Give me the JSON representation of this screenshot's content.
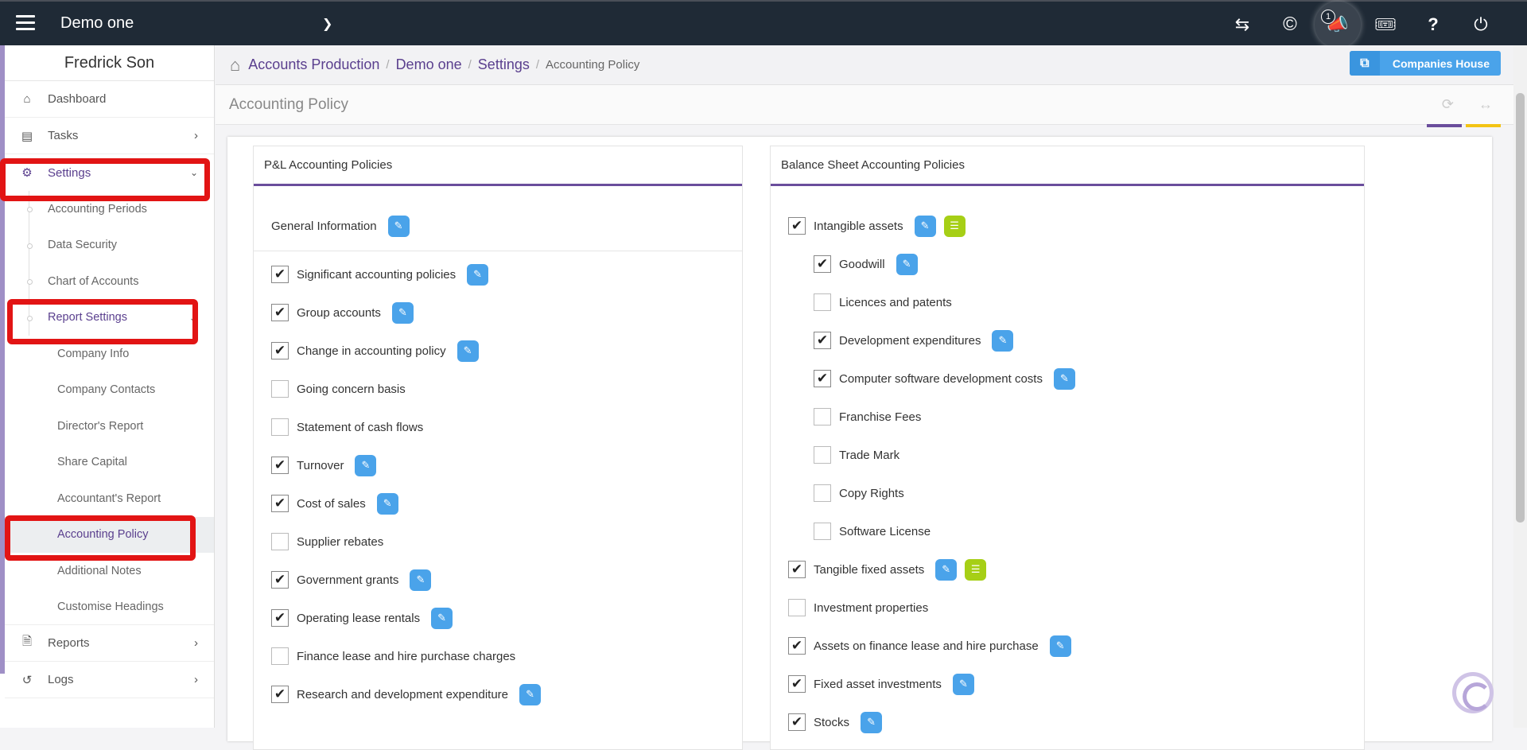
{
  "topbar": {
    "title": "Demo one",
    "notification_count": "1",
    "icons": [
      "swap-icon",
      "copyright-icon",
      "megaphone-icon",
      "ticket-icon",
      "help-icon",
      "power-icon"
    ]
  },
  "sidebar": {
    "user_name": "Fredrick Son",
    "items": {
      "dashboard": "Dashboard",
      "tasks": "Tasks",
      "settings": "Settings",
      "reports": "Reports",
      "logs": "Logs"
    },
    "settings_sub": {
      "accounting_periods": "Accounting Periods",
      "data_security": "Data Security",
      "chart_of_accounts": "Chart of Accounts",
      "report_settings": "Report Settings"
    },
    "report_sub": {
      "company_info": "Company Info",
      "company_contacts": "Company Contacts",
      "directors_report": "Director's Report",
      "share_capital": "Share Capital",
      "accountants_report": "Accountant's Report",
      "accounting_policy": "Accounting Policy",
      "additional_notes": "Additional Notes",
      "customise_headings": "Customise Headings"
    }
  },
  "breadcrumb": {
    "c1": "Accounts Production",
    "c2": "Demo one",
    "c3": "Settings",
    "c4": "Accounting Policy"
  },
  "companies_house_label": "Companies House",
  "page_title": "Accounting Policy",
  "pl": {
    "title": "P&L Accounting Policies",
    "general_info": "General Information",
    "items": [
      {
        "label": "Significant accounting policies",
        "checked": true,
        "edit": true
      },
      {
        "label": "Group accounts",
        "checked": true,
        "edit": true
      },
      {
        "label": "Change in accounting policy",
        "checked": true,
        "edit": true
      },
      {
        "label": "Going concern basis",
        "checked": false,
        "edit": false
      },
      {
        "label": "Statement of cash flows",
        "checked": false,
        "edit": false
      },
      {
        "label": "Turnover",
        "checked": true,
        "edit": true
      },
      {
        "label": "Cost of sales",
        "checked": true,
        "edit": true
      },
      {
        "label": "Supplier rebates",
        "checked": false,
        "edit": false
      },
      {
        "label": "Government grants",
        "checked": true,
        "edit": true
      },
      {
        "label": "Operating lease rentals",
        "checked": true,
        "edit": true
      },
      {
        "label": "Finance lease and hire purchase charges",
        "checked": false,
        "edit": false
      },
      {
        "label": "Research and development expenditure",
        "checked": true,
        "edit": true
      }
    ]
  },
  "bs": {
    "title": "Balance Sheet Accounting Policies",
    "items": [
      {
        "label": "Intangible assets",
        "checked": true,
        "edit": true,
        "list": true,
        "indent": false
      },
      {
        "label": "Goodwill",
        "checked": true,
        "edit": true,
        "list": false,
        "indent": true
      },
      {
        "label": "Licences and patents",
        "checked": false,
        "edit": false,
        "list": false,
        "indent": true
      },
      {
        "label": "Development expenditures",
        "checked": true,
        "edit": true,
        "list": false,
        "indent": true
      },
      {
        "label": "Computer software development costs",
        "checked": true,
        "edit": true,
        "list": false,
        "indent": true
      },
      {
        "label": "Franchise Fees",
        "checked": false,
        "edit": false,
        "list": false,
        "indent": true
      },
      {
        "label": "Trade Mark",
        "checked": false,
        "edit": false,
        "list": false,
        "indent": true
      },
      {
        "label": "Copy Rights",
        "checked": false,
        "edit": false,
        "list": false,
        "indent": true
      },
      {
        "label": "Software License",
        "checked": false,
        "edit": false,
        "list": false,
        "indent": true
      },
      {
        "label": "Tangible fixed assets",
        "checked": true,
        "edit": true,
        "list": true,
        "indent": false
      },
      {
        "label": "Investment properties",
        "checked": false,
        "edit": false,
        "list": false,
        "indent": false
      },
      {
        "label": "Assets on finance lease and hire purchase",
        "checked": true,
        "edit": true,
        "list": false,
        "indent": false
      },
      {
        "label": "Fixed asset investments",
        "checked": true,
        "edit": true,
        "list": false,
        "indent": false
      },
      {
        "label": "Stocks",
        "checked": true,
        "edit": true,
        "list": false,
        "indent": false
      }
    ]
  },
  "colors": {
    "topbar": "#1f2a36",
    "accent_purple": "#5a3f8e",
    "edit_blue": "#4aa3ea",
    "list_green": "#a6cf16",
    "highlight_red": "#e21414"
  }
}
